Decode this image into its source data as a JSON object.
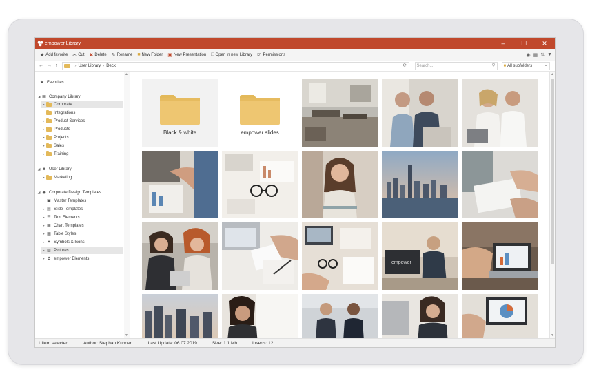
{
  "window": {
    "title": "empower Library",
    "titlebar_color": "#c0482c"
  },
  "toolbar": {
    "items": [
      {
        "label": "Add favorite",
        "icon": "star-plus-icon"
      },
      {
        "label": "Cut",
        "icon": "scissors-icon"
      },
      {
        "label": "Delete",
        "icon": "delete-x-icon"
      },
      {
        "label": "Rename",
        "icon": "rename-icon"
      },
      {
        "label": "New Folder",
        "icon": "new-folder-icon"
      },
      {
        "label": "New Presentation",
        "icon": "new-presentation-icon"
      },
      {
        "label": "Open in new Library",
        "icon": "open-library-icon"
      },
      {
        "label": "Permissions",
        "icon": "permissions-icon"
      }
    ]
  },
  "address": {
    "breadcrumb": [
      "User Library",
      "Deck"
    ],
    "search_placeholder": "Search...",
    "filter_value": "All subfolders"
  },
  "sidebar": {
    "favorites": "Favorites",
    "company_library": "Company Library",
    "company_items": [
      "Corporate",
      "Integrations",
      "Product Services",
      "Products",
      "Projects",
      "Sales",
      "Training"
    ],
    "user_library": "User Library",
    "user_items": [
      "Marketing"
    ],
    "cdt": "Corporate Design Templates",
    "cdt_items": [
      "Master Templates",
      "Slide Templates",
      "Text Elements",
      "Chart Templates",
      "Table Styles",
      "Symbols & Icons",
      "Pictures",
      "empower Elements"
    ]
  },
  "content": {
    "folders": [
      "Black & white",
      "empower slides"
    ]
  },
  "status": {
    "selected": "1 Item selected",
    "author": "Author: Stephan Kuhnert",
    "last_update": "Last Update: 06.07.2019",
    "size": "Size: 1.1 Mb",
    "inserts": "Inserts: 12"
  }
}
